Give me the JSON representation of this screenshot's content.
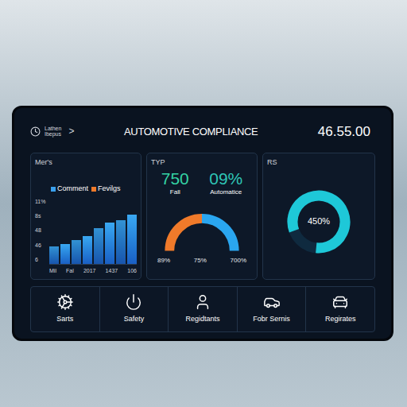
{
  "header": {
    "logo_lines": [
      "Lathen",
      "Ibepus"
    ],
    "chevron": ">",
    "title": "AUTOMOTIVE COMPLIANCE",
    "value": "46.55.00"
  },
  "bar_chart": {
    "title": "Mer's",
    "legend": [
      {
        "label": "Comment",
        "color": "#3aa0ee"
      },
      {
        "label": "Fevilgs",
        "color": "#f07a2a"
      }
    ],
    "y_ticks": [
      "11%",
      "8s",
      "48",
      "46",
      "6"
    ],
    "x_labels": [
      "Mil",
      "Fal",
      "2017",
      "1437",
      "106"
    ],
    "series": [
      {
        "name": "Comment",
        "color": "#2f8fe8",
        "values": [
          2.6,
          3.0,
          3.5,
          4.2,
          5.4,
          6.2,
          6.6,
          7.4
        ]
      }
    ],
    "max": 10
  },
  "kpi_card": {
    "title": "TYP",
    "kpis": [
      {
        "value": "750",
        "label": "Fall",
        "color": "#34d3a4"
      },
      {
        "value": "09%",
        "label": "Automatice",
        "color": "#2fc6b6"
      }
    ],
    "gauge": {
      "level": 0.5,
      "labels": [
        "89%",
        "75%",
        "700%"
      ]
    }
  },
  "donut_card": {
    "title": "RS",
    "level": 0.82,
    "center": "450%"
  },
  "nav": [
    {
      "label": "Sarts"
    },
    {
      "label": "Safety"
    },
    {
      "label": "Regidtants"
    },
    {
      "label": "Fobr Sernis"
    },
    {
      "label": "Regirates"
    }
  ]
}
